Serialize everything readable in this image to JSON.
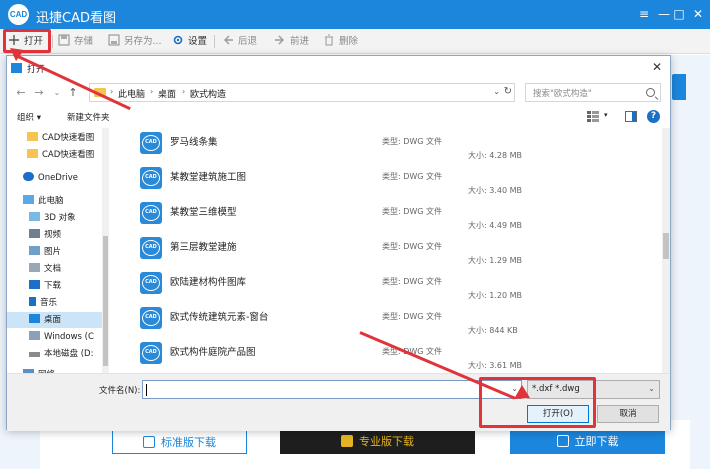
{
  "app": {
    "title": "迅捷CAD看图",
    "logo_text": "CAD",
    "window_controls": {
      "menu": "≡",
      "minimize": "—",
      "maximize": "□",
      "close": "✕"
    }
  },
  "toolbar": {
    "open": "打开",
    "save": "存储",
    "save_as": "另存为...",
    "settings": "设置",
    "back": "后退",
    "forward": "前进",
    "delete": "删除"
  },
  "dialog": {
    "title": "打开",
    "breadcrumb": [
      "此电脑",
      "桌面",
      "欧式构造"
    ],
    "search_placeholder": "搜索\"欧式构造\"",
    "organize": "组织 ▾",
    "new_folder": "新建文件夹",
    "help": "?",
    "tree": [
      {
        "label": "CAD快速看图",
        "icon": "folder"
      },
      {
        "label": "CAD快速看图",
        "icon": "folder"
      },
      {
        "label": "OneDrive",
        "icon": "cloud"
      },
      {
        "label": "此电脑",
        "icon": "computer"
      },
      {
        "label": "3D 对象",
        "icon": "3d"
      },
      {
        "label": "视频",
        "icon": "video"
      },
      {
        "label": "图片",
        "icon": "picture"
      },
      {
        "label": "文档",
        "icon": "document"
      },
      {
        "label": "下载",
        "icon": "download"
      },
      {
        "label": "音乐",
        "icon": "music"
      },
      {
        "label": "桌面",
        "icon": "desktop",
        "selected": true
      },
      {
        "label": "Windows (C",
        "icon": "drive-windows"
      },
      {
        "label": "本地磁盘 (D:",
        "icon": "drive"
      },
      {
        "label": "网络",
        "icon": "network"
      }
    ],
    "files": [
      {
        "name": "罗马线条集",
        "type": "类型: DWG 文件",
        "size": "大小: 4.28 MB"
      },
      {
        "name": "某教堂建筑施工图",
        "type": "类型: DWG 文件",
        "size": "大小: 3.40 MB"
      },
      {
        "name": "某教堂三维模型",
        "type": "类型: DWG 文件",
        "size": "大小: 4.49 MB"
      },
      {
        "name": "第三层教堂建施",
        "type": "类型: DWG 文件",
        "size": "大小: 1.29 MB"
      },
      {
        "name": "欧陆建材构件图库",
        "type": "类型: DWG 文件",
        "size": "大小: 1.20 MB"
      },
      {
        "name": "欧式传统建筑元素-窗台",
        "type": "类型: DWG 文件",
        "size": "大小: 844 KB"
      },
      {
        "name": "欧式构件庭院产品图",
        "type": "类型: DWG 文件",
        "size": "大小: 3.61 MB"
      }
    ],
    "filename_label": "文件名(N):",
    "filename_value": "",
    "filter": "*.dxf *.dwg",
    "open_button": "打开(O)",
    "cancel_button": "取消"
  },
  "background": {
    "standard_download": "标准版下载",
    "pro_download": "专业版下载",
    "download_now": "立即下载"
  },
  "colors": {
    "brand_blue": "#1b86dc",
    "annotation_red": "#e0343a",
    "pro_dark": "#1e1e1e",
    "pro_gold": "#e6b422"
  }
}
